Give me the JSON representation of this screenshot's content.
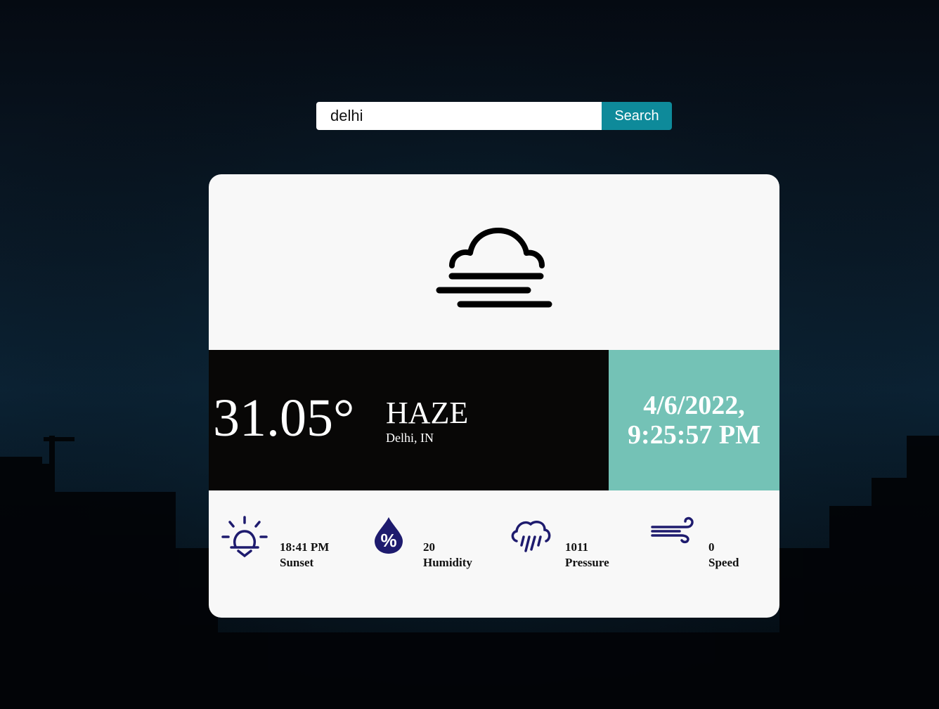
{
  "search": {
    "value": "delhi",
    "placeholder": "",
    "button_label": "Search"
  },
  "weather": {
    "icon": "haze-icon",
    "temperature": "31.05°",
    "condition": "HAZE",
    "location": "Delhi, IN",
    "date": "4/6/2022,",
    "time": "9:25:57 PM"
  },
  "stats": [
    {
      "icon": "sunset-icon",
      "value": "18:41 PM",
      "label": "Sunset"
    },
    {
      "icon": "humidity-icon",
      "value": "20",
      "label": "Humidity"
    },
    {
      "icon": "pressure-icon",
      "value": "1011",
      "label": "Pressure"
    },
    {
      "icon": "wind-icon",
      "value": "0",
      "label": "Speed"
    }
  ],
  "colors": {
    "accent_button": "#0e8a9a",
    "date_panel": "#74c2b6",
    "temp_panel": "#080706",
    "stat_icon": "#1e1b6e"
  }
}
